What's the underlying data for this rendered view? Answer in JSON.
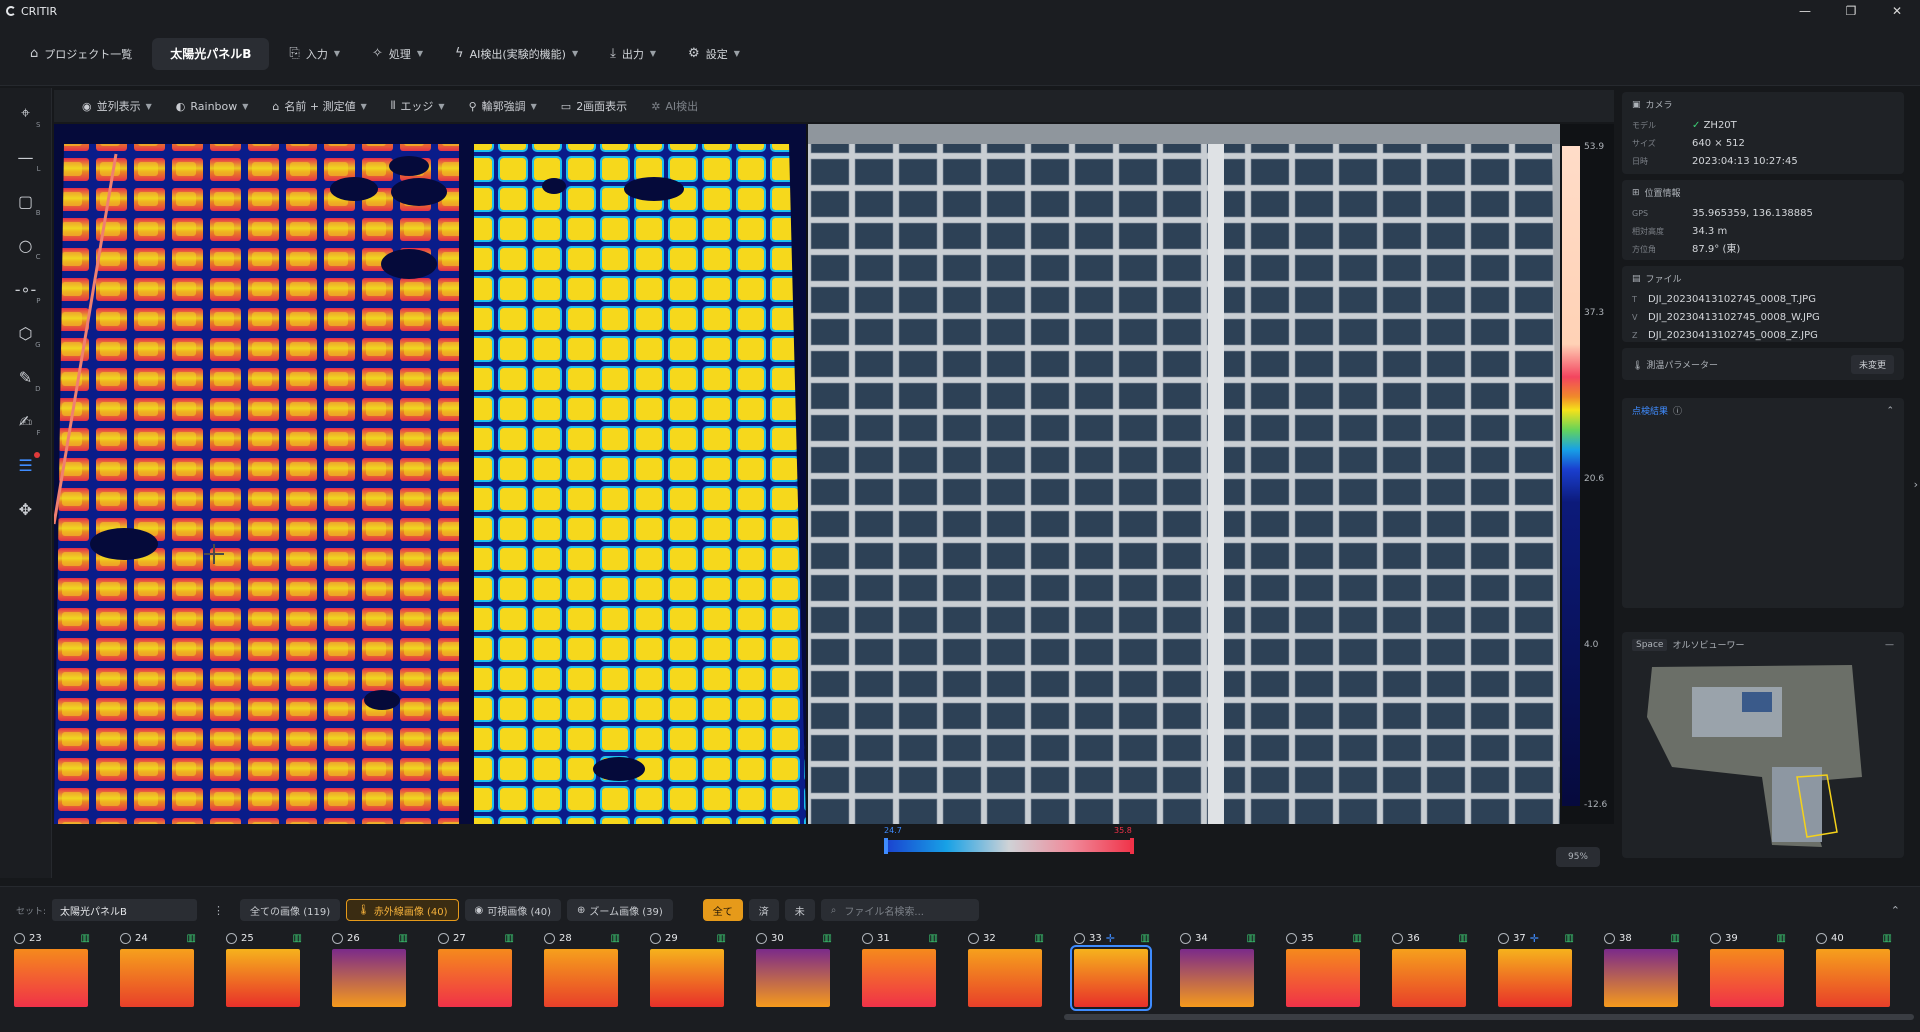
{
  "app": {
    "title": "CRITIR",
    "window_controls": [
      "—",
      "❐",
      "✕"
    ]
  },
  "topnav": {
    "project_list": "プロジェクト一覧",
    "active_tab": "太陽光パネルB",
    "input": "入力",
    "process": "処理",
    "ai_detect": "AI検出(実験的機能)",
    "output": "出力",
    "settings": "設定"
  },
  "tools": [
    {
      "icon": "crosshair-icon",
      "key": "S"
    },
    {
      "icon": "line-icon",
      "key": "L"
    },
    {
      "icon": "box-icon",
      "key": "B"
    },
    {
      "icon": "circle-icon",
      "key": "C"
    },
    {
      "icon": "point-icon",
      "key": "P"
    },
    {
      "icon": "polygon-icon",
      "key": "G"
    },
    {
      "icon": "pen-icon",
      "key": "D"
    },
    {
      "icon": "edit-icon",
      "key": "F"
    },
    {
      "icon": "adjust-icon",
      "key": ""
    },
    {
      "icon": "move-icon",
      "key": ""
    }
  ],
  "viewtool": {
    "parallel": "並列表示",
    "palette": "Rainbow",
    "label_mode": "名前 + 測定値",
    "edge": "エッジ",
    "contour": "輪郭強調",
    "dual": "2画面表示",
    "ai": "AI検出"
  },
  "scale": {
    "max": "53.9",
    "t1": "37.3",
    "t2": "20.6",
    "t3": "4.0",
    "min": "-12.6"
  },
  "histogram": {
    "low": "24.7",
    "high": "35.8"
  },
  "zoom": "95%",
  "camera": {
    "title": "カメラ",
    "model_k": "モデル",
    "model": "ZH20T",
    "size_k": "サイズ",
    "size": "640 × 512",
    "date_k": "日時",
    "date": "2023:04:13 10:27:45"
  },
  "location": {
    "title": "位置情報",
    "gps_k": "GPS",
    "gps": "35.965359, 136.138885",
    "alt_k": "相対高度",
    "alt": "34.3 m",
    "az_k": "方位角",
    "az": "87.9° (東)"
  },
  "files": {
    "title": "ファイル",
    "t": "DJI_20230413102745_0008_T.JPG",
    "v": "DJI_20230413102745_0008_W.JPG",
    "z": "DJI_20230413102745_0008_Z.JPG"
  },
  "params": {
    "title": "測温パラメーター",
    "state": "未変更"
  },
  "inspection": {
    "title": "点検結果"
  },
  "ortho": {
    "space": "Space",
    "title": "オルソビューワー"
  },
  "filter": {
    "set_label": "セット:",
    "set_value": "太陽光パネルB",
    "all": "全ての画像 (119)",
    "ir": "赤外線画像 (40)",
    "vis": "可視画像 (40)",
    "zoom": "ズーム画像 (39)",
    "f_all": "全て",
    "f_done": "済",
    "f_undone": "未",
    "search_placeholder": "ファイル名検索..."
  },
  "thumbs": [
    {
      "n": "23"
    },
    {
      "n": "24"
    },
    {
      "n": "25"
    },
    {
      "n": "26"
    },
    {
      "n": "27"
    },
    {
      "n": "28"
    },
    {
      "n": "29"
    },
    {
      "n": "30"
    },
    {
      "n": "31"
    },
    {
      "n": "32"
    },
    {
      "n": "33"
    },
    {
      "n": "34"
    },
    {
      "n": "35"
    },
    {
      "n": "36"
    },
    {
      "n": "37"
    },
    {
      "n": "38"
    },
    {
      "n": "39"
    },
    {
      "n": "40"
    }
  ]
}
